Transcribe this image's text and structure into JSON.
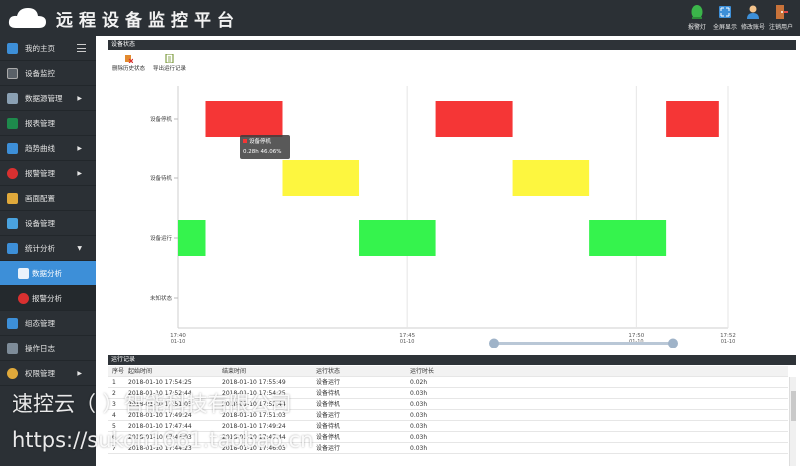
{
  "header": {
    "title": "远程设备监控平台",
    "buttons": [
      {
        "label": "报警灯",
        "icon": "alarm-light-icon"
      },
      {
        "label": "全屏显示",
        "icon": "fullscreen-icon"
      },
      {
        "label": "修改账号",
        "icon": "user-icon"
      },
      {
        "label": "注销用户",
        "icon": "logout-icon"
      }
    ]
  },
  "sidebar": {
    "items": [
      {
        "label": "我的主页",
        "icon": "home-icon"
      },
      {
        "label": "设备监控",
        "icon": "monitor-icon"
      },
      {
        "label": "数据源管理",
        "icon": "datasource-icon",
        "arrow": "▶"
      },
      {
        "label": "报表管理",
        "icon": "excel-icon"
      },
      {
        "label": "趋势曲线",
        "icon": "trend-icon",
        "arrow": "▶"
      },
      {
        "label": "报警管理",
        "icon": "alarm-icon",
        "arrow": "▶"
      },
      {
        "label": "画面配置",
        "icon": "screen-icon"
      },
      {
        "label": "设备管理",
        "icon": "device-icon"
      },
      {
        "label": "统计分析",
        "icon": "statistics-icon",
        "arrow": "▼"
      },
      {
        "label": "数据分析",
        "icon": "data-analysis-icon",
        "sub": true,
        "active": true
      },
      {
        "label": "报警分析",
        "icon": "alarm-analysis-icon",
        "sub": true
      },
      {
        "label": "组态管理",
        "icon": "config-icon"
      },
      {
        "label": "操作日志",
        "icon": "log-icon"
      },
      {
        "label": "权限管理",
        "icon": "key-icon",
        "arrow": "▶"
      }
    ]
  },
  "status_panel": {
    "title": "设备状态",
    "toolbar": [
      {
        "label": "删除历史状态",
        "icon": "delete-history-icon"
      },
      {
        "label": "导出运行记录",
        "icon": "export-icon"
      }
    ]
  },
  "chart_data": {
    "type": "timeline",
    "categories": [
      "设备停机",
      "设备待机",
      "设备运行",
      "未知状态"
    ],
    "x_ticks": [
      {
        "time": "17:40",
        "date": "01-10"
      },
      {
        "time": "17:45",
        "date": "01-10"
      },
      {
        "time": "17:50",
        "date": "01-10"
      },
      {
        "time": "17:52",
        "date": "01-10"
      }
    ],
    "colors": {
      "设备停机": "#f53636",
      "设备待机": "#fdf63f",
      "设备运行": "#35f34d"
    },
    "segments": [
      {
        "state": "设备运行",
        "start": 0.0,
        "end": 0.6
      },
      {
        "state": "设备停机",
        "start": 0.6,
        "end": 2.28
      },
      {
        "state": "设备待机",
        "start": 2.28,
        "end": 3.95
      },
      {
        "state": "设备运行",
        "start": 3.95,
        "end": 5.62
      },
      {
        "state": "设备停机",
        "start": 5.62,
        "end": 7.3
      },
      {
        "state": "设备待机",
        "start": 7.3,
        "end": 8.97
      },
      {
        "state": "设备运行",
        "start": 8.97,
        "end": 10.65
      },
      {
        "state": "设备停机",
        "start": 10.65,
        "end": 11.8
      }
    ],
    "tooltip": {
      "state": "设备停机",
      "value": "0.28h  46.06%"
    }
  },
  "records": {
    "title": "运行记录",
    "columns": [
      "序号",
      "起始时间",
      "结束时间",
      "运行状态",
      "运行时长"
    ],
    "rows": [
      [
        "1",
        "2018-01-10 17:54:25",
        "2018-01-10 17:55:49",
        "设备运行",
        "0.02h"
      ],
      [
        "2",
        "2018-01-10 17:52:44",
        "2018-01-10 17:54:25",
        "设备待机",
        "0.03h"
      ],
      [
        "3",
        "2018-01-10 17:51:03",
        "2018-01-10 17:52:44",
        "设备停机",
        "0.03h"
      ],
      [
        "4",
        "2018-01-10 17:49:24",
        "2018-01-10 17:51:03",
        "设备运行",
        "0.03h"
      ],
      [
        "5",
        "2018-01-10 17:47:44",
        "2018-01-10 17:49:24",
        "设备待机",
        "0.03h"
      ],
      [
        "6",
        "2018-01-10 17:46:03",
        "2018-01-10 17:47:44",
        "设备停机",
        "0.03h"
      ],
      [
        "7",
        "2018-01-10 17:44:23",
        "2018-01-10 17:46:03",
        "设备运行",
        "0.03h"
      ]
    ]
  },
  "watermark": {
    "line1": "速控云（ ）智能科技有限公司",
    "line2": "https://sukon1661.taobao.cn"
  }
}
